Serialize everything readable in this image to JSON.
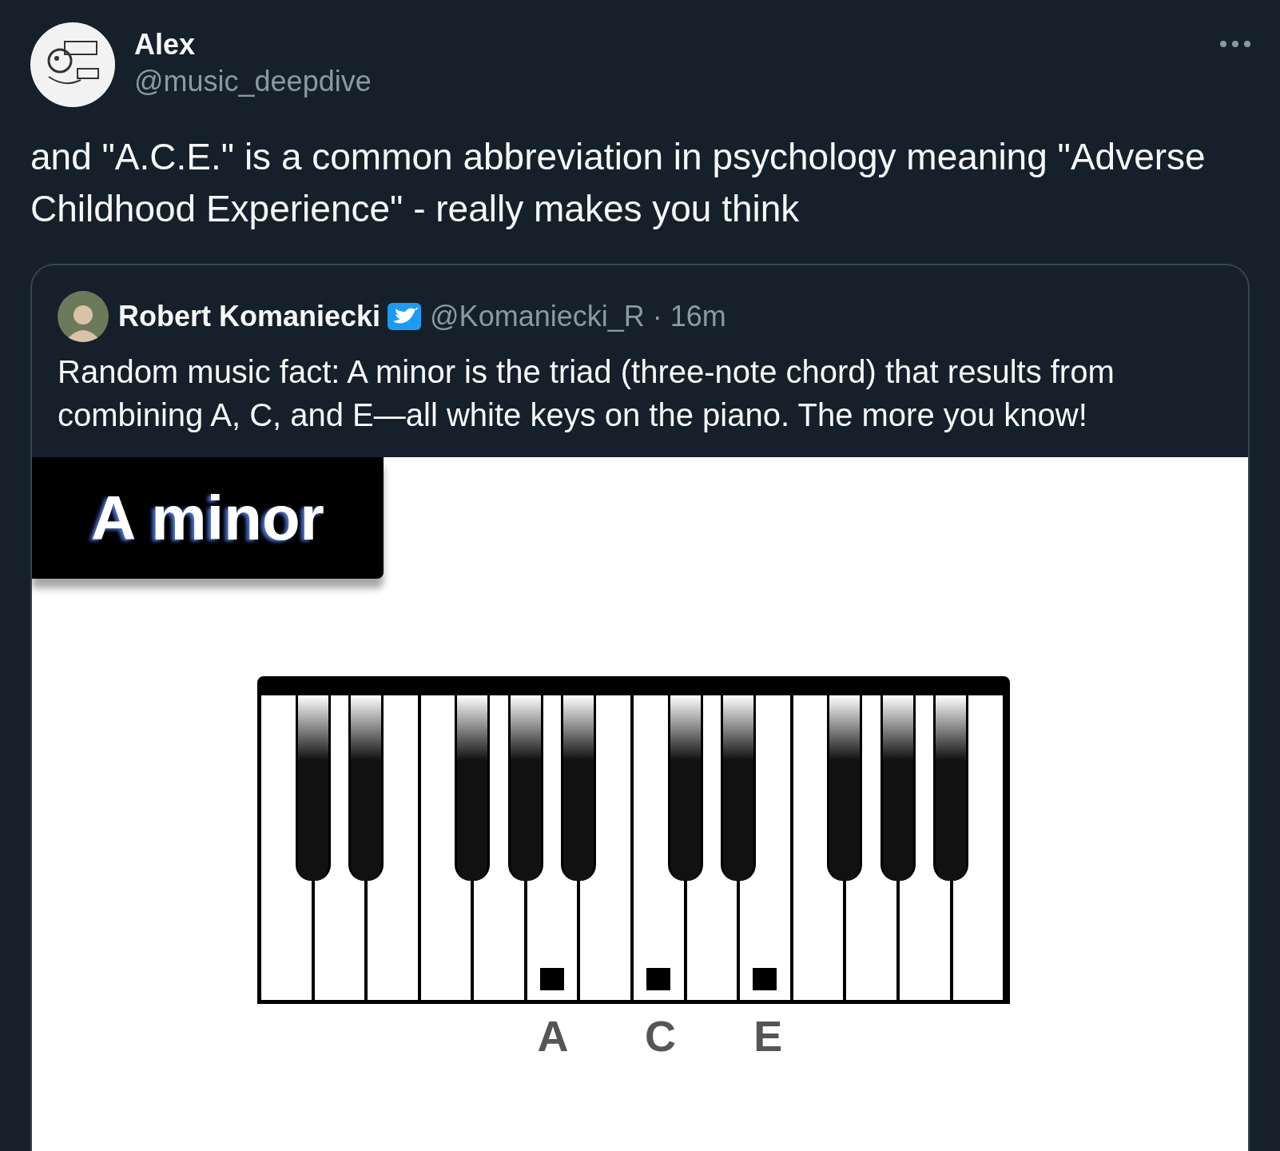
{
  "author": {
    "name": "Alex",
    "handle": "@music_deepdive"
  },
  "text": "and \"A.C.E.\" is a common abbreviation in psychology meaning \"Adverse Childhood Experience\" - really makes you think",
  "quoted": {
    "author": {
      "name": "Robert Komaniecki",
      "verified": true,
      "handle": "@Komaniecki_R",
      "separator": "·",
      "time": "16m"
    },
    "text": "Random music fact: A minor is the triad (three-note chord) that results from combining A, C, and E—all white keys on the piano. The more you know!",
    "image": {
      "title": "A minor",
      "white_keys": [
        {
          "marked": false
        },
        {
          "marked": false
        },
        {
          "marked": false
        },
        {
          "marked": false
        },
        {
          "marked": false
        },
        {
          "marked": true,
          "label": "A"
        },
        {
          "marked": false
        },
        {
          "marked": true,
          "label": "C"
        },
        {
          "marked": false
        },
        {
          "marked": true,
          "label": "E"
        },
        {
          "marked": false
        },
        {
          "marked": false
        },
        {
          "marked": false
        },
        {
          "marked": false
        }
      ]
    }
  }
}
